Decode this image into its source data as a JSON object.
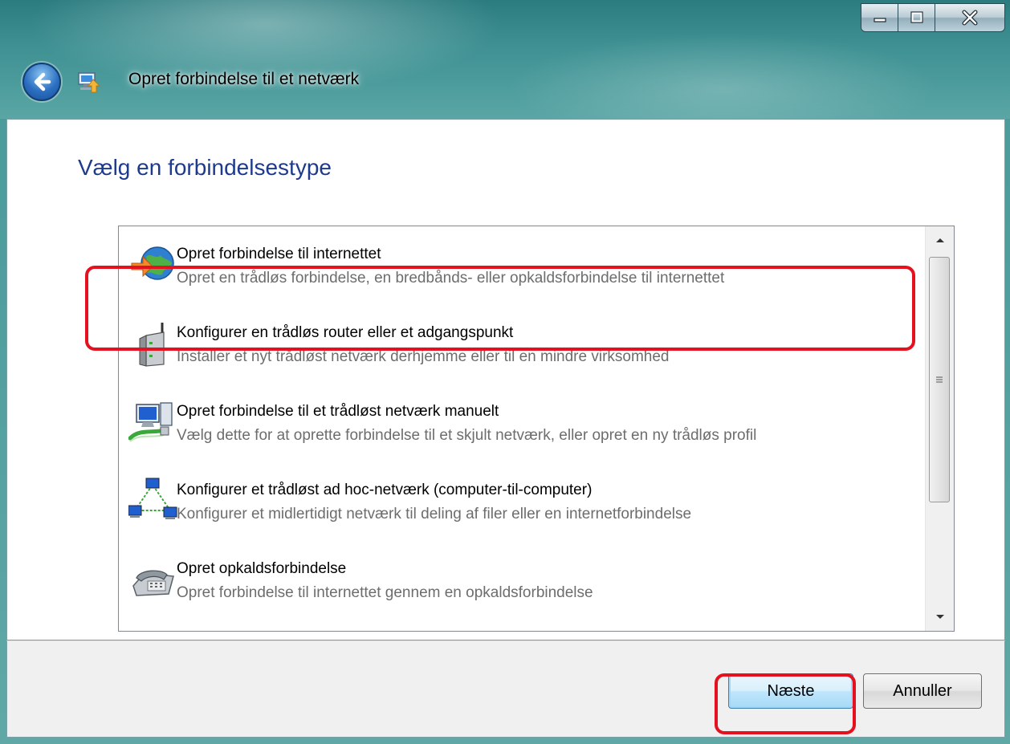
{
  "window": {
    "title": "Opret forbindelse til et netværk",
    "controls": [
      "minimize-icon",
      "maximize-icon",
      "close-icon"
    ]
  },
  "page": {
    "heading": "Vælg en forbindelsestype"
  },
  "options": [
    {
      "icon": "globe-internet-icon",
      "title": "Opret forbindelse til internettet",
      "description": "Opret en trådløs forbindelse, en bredbånds- eller opkaldsforbindelse til internettet"
    },
    {
      "icon": "wireless-router-icon",
      "title": "Konfigurer en trådløs router eller et adgangspunkt",
      "description": "Installer et nyt trådløst netværk derhjemme eller til en mindre virksomhed"
    },
    {
      "icon": "manual-wireless-network-icon",
      "title": "Opret forbindelse til et trådløst netværk manuelt",
      "description": "Vælg dette for at oprette forbindelse til et skjult netværk, eller opret en ny trådløs profil"
    },
    {
      "icon": "adhoc-network-icon",
      "title": "Konfigurer et trådløst ad hoc-netværk (computer-til-computer)",
      "description": "Konfigurer et midlertidigt netværk til deling af filer eller en internetforbindelse"
    },
    {
      "icon": "dialup-phone-icon",
      "title": "Opret opkaldsforbindelse",
      "description": "Opret forbindelse til internettet gennem en opkaldsforbindelse"
    }
  ],
  "buttons": {
    "next": "Næste",
    "cancel": "Annuller"
  },
  "colors": {
    "heading": "#1e3a8c",
    "highlight": "#e5111f"
  }
}
